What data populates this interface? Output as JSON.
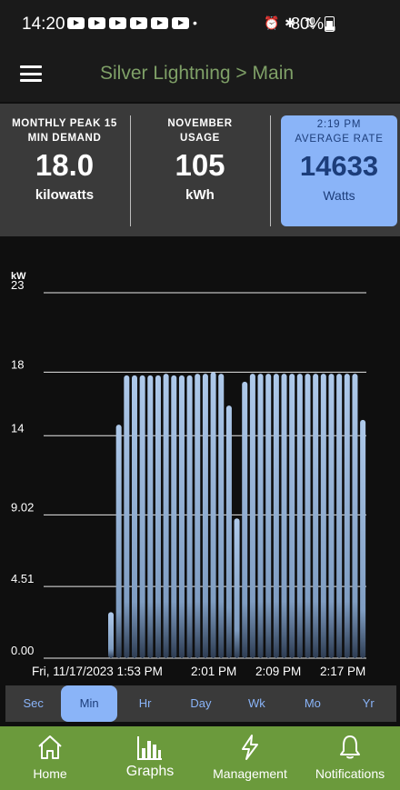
{
  "status_bar": {
    "time": "14:20",
    "battery": "80%"
  },
  "app_bar": {
    "title": "Silver Lightning > Main"
  },
  "stats": {
    "peak": {
      "label_line1": "MONTHLY PEAK 15",
      "label_line2": "MIN DEMAND",
      "value": "18.0",
      "unit": "kilowatts"
    },
    "usage": {
      "label_line1": "NOVEMBER",
      "label_line2": "USAGE",
      "value": "105",
      "unit": "kWh"
    },
    "rate": {
      "time": "2:19 PM",
      "label": "AVERAGE RATE",
      "value": "14633",
      "unit": "Watts"
    }
  },
  "chart_data": {
    "type": "bar",
    "ylabel": "kW",
    "yticks": [
      "23",
      "18",
      "14",
      "9.02",
      "4.51",
      "0.00"
    ],
    "ytick_values": [
      23,
      18,
      14,
      9.02,
      4.51,
      0
    ],
    "ylim": [
      0,
      23
    ],
    "xtick_labels": [
      "Fri, 11/17/2023 1:53 PM",
      "2:01 PM",
      "2:09 PM",
      "2:17 PM"
    ],
    "values": [
      2.9,
      14.7,
      17.8,
      17.8,
      17.8,
      17.8,
      17.8,
      17.9,
      17.8,
      17.8,
      17.8,
      17.9,
      17.9,
      18.0,
      17.9,
      15.9,
      8.8,
      17.4,
      17.9,
      17.9,
      17.9,
      17.9,
      17.9,
      17.9,
      17.9,
      17.9,
      17.9,
      17.9,
      17.9,
      17.9,
      17.9,
      17.9,
      15.0
    ],
    "bar_color": "#a9c3e3",
    "grid": true
  },
  "periods": [
    "Sec",
    "Min",
    "Hr",
    "Day",
    "Wk",
    "Mo",
    "Yr"
  ],
  "active_period": "Min",
  "bottom_nav": [
    {
      "label": "Home",
      "icon": "home-icon"
    },
    {
      "label": "Graphs",
      "icon": "bar-chart-icon"
    },
    {
      "label": "Management",
      "icon": "lightning-icon"
    },
    {
      "label": "Notifications",
      "icon": "bell-icon"
    }
  ],
  "colors": {
    "accent": "#8ab4f8",
    "title": "#7fa067",
    "nav": "#6b9a3c"
  }
}
